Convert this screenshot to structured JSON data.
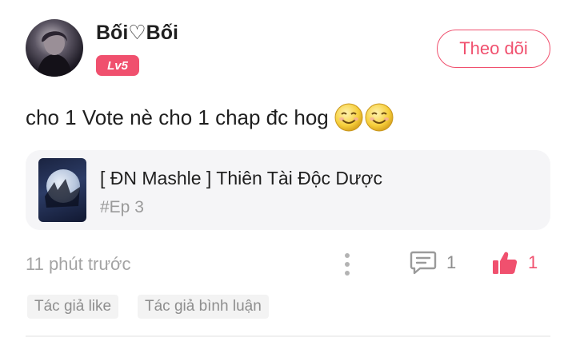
{
  "user": {
    "name": "Bối♡Bối",
    "level": "Lv5"
  },
  "follow_button": {
    "label": "Theo dõi"
  },
  "comment": {
    "text": "cho 1 Vote nè cho 1 chap đc hog"
  },
  "story": {
    "title": "[ ĐN Mashle ] Thiên Tài Độc Dược",
    "episode": "#Ep 3"
  },
  "meta": {
    "time": "11 phút trước",
    "reply_count": "1",
    "like_count": "1"
  },
  "tags": {
    "author_like": "Tác giả like",
    "author_comment": "Tác giả bình luận"
  },
  "colors": {
    "accent": "#f0506e",
    "muted": "#a4a4a4"
  },
  "icons": [
    "avatar",
    "smiley-emoji",
    "more-vertical-icon",
    "comment-icon",
    "thumbs-up-icon"
  ]
}
